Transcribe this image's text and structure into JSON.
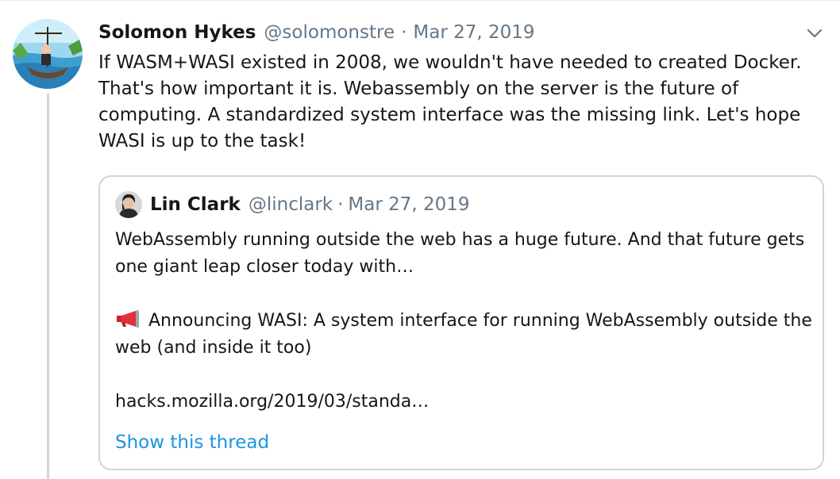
{
  "tweet": {
    "author_name": "Solomon Hykes",
    "author_handle": "@solomonstre",
    "separator": "·",
    "date": "Mar 27, 2019",
    "text": "If WASM+WASI existed in 2008, we wouldn't have needed to created Docker. That's how important it is. Webassembly on the server is the future of computing. A standardized system interface was the missing link. Let's hope WASI is up to the task!",
    "caret_icon": "chevron-down-icon",
    "avatar_icon": "avatar-illustration"
  },
  "quoted_tweet": {
    "author_name": "Lin Clark",
    "author_handle": "@linclark",
    "separator": "·",
    "date": "Mar 27, 2019",
    "paragraph_1": "WebAssembly running outside the web has a huge future. And that future gets one giant leap closer today with…",
    "paragraph_2": "Announcing WASI: A system interface for running WebAssembly outside the web (and inside it too)",
    "link": "hacks.mozilla.org/2019/03/standa…",
    "show_thread": "Show this thread",
    "megaphone_icon": "megaphone-icon"
  },
  "colors": {
    "text_primary": "#14171a",
    "text_secondary": "#657786",
    "link_blue": "#1b95e0",
    "border": "#ccd6dd"
  }
}
